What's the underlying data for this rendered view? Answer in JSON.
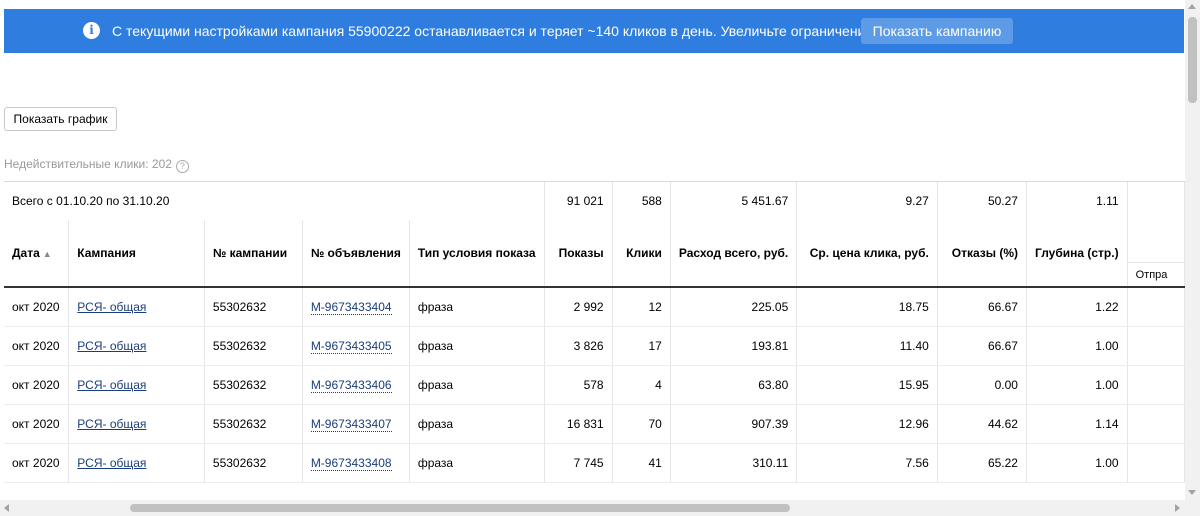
{
  "banner": {
    "message": "С текущими настройками кампания 55900222 останавливается и теряет ~140 кликов в день. Увеличьте ограничение бюджета.",
    "button_label": "Показать кампанию",
    "icon": "info-icon"
  },
  "show_graph_label": "Показать график",
  "invalid_clicks_label": "Недействительные клики: 202",
  "table": {
    "total": {
      "label": "Всего с 01.10.20 по 31.10.20",
      "impressions": "91 021",
      "clicks": "588",
      "spend": "5 451.67",
      "avg_cpc": "9.27",
      "bounces": "50.27",
      "depth": "1.11"
    },
    "headers": {
      "date": "Дата",
      "campaign": "Кампания",
      "campaign_no": "№ кампании",
      "ad_no": "№ объявления",
      "condition_type": "Тип условия показа",
      "impressions": "Показы",
      "clicks": "Клики",
      "spend": "Расход всего, руб.",
      "avg_cpc": "Ср. цена клика, руб.",
      "bounces": "Отказы (%)",
      "depth": "Глубина (стр.)",
      "sub_partial": "Отпра"
    },
    "rows": [
      {
        "date": "окт 2020",
        "campaign": "РСЯ- общая",
        "campaign_no": "55302632",
        "ad_no": "M-9673433404",
        "condition_type": "фраза",
        "impressions": "2 992",
        "clicks": "12",
        "spend": "225.05",
        "avg_cpc": "18.75",
        "bounces": "66.67",
        "depth": "1.22"
      },
      {
        "date": "окт 2020",
        "campaign": "РСЯ- общая",
        "campaign_no": "55302632",
        "ad_no": "M-9673433405",
        "condition_type": "фраза",
        "impressions": "3 826",
        "clicks": "17",
        "spend": "193.81",
        "avg_cpc": "11.40",
        "bounces": "66.67",
        "depth": "1.00"
      },
      {
        "date": "окт 2020",
        "campaign": "РСЯ- общая",
        "campaign_no": "55302632",
        "ad_no": "M-9673433406",
        "condition_type": "фраза",
        "impressions": "578",
        "clicks": "4",
        "spend": "63.80",
        "avg_cpc": "15.95",
        "bounces": "0.00",
        "depth": "1.00"
      },
      {
        "date": "окт 2020",
        "campaign": "РСЯ- общая",
        "campaign_no": "55302632",
        "ad_no": "M-9673433407",
        "condition_type": "фраза",
        "impressions": "16 831",
        "clicks": "70",
        "spend": "907.39",
        "avg_cpc": "12.96",
        "bounces": "44.62",
        "depth": "1.14"
      },
      {
        "date": "окт 2020",
        "campaign": "РСЯ- общая",
        "campaign_no": "55302632",
        "ad_no": "M-9673433408",
        "condition_type": "фраза",
        "impressions": "7 745",
        "clicks": "41",
        "spend": "310.11",
        "avg_cpc": "7.56",
        "bounces": "65.22",
        "depth": "1.00"
      }
    ]
  },
  "colors": {
    "banner_bg": "#2f7ddf",
    "banner_button_bg": "#5e9be6",
    "link": "#1a3d7c"
  }
}
